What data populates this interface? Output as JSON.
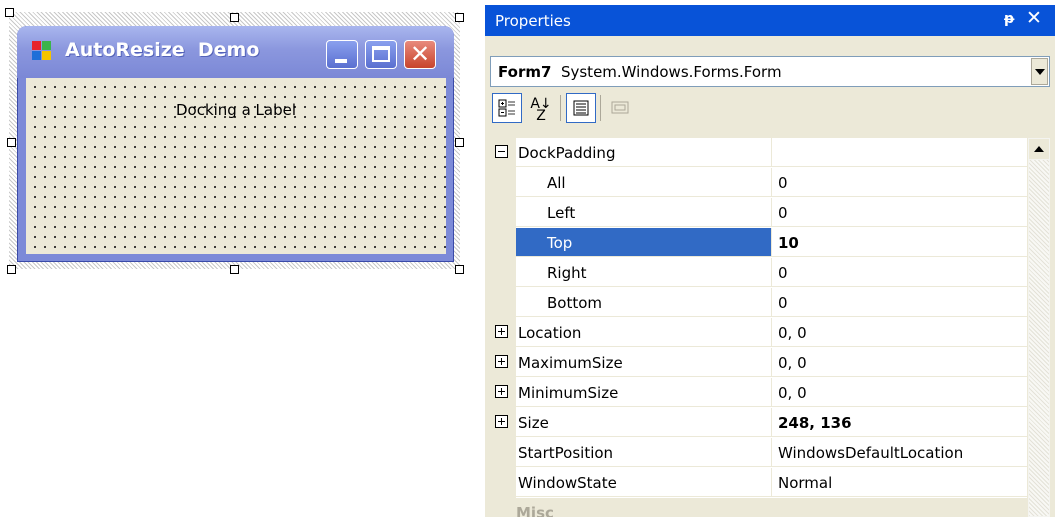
{
  "designer": {
    "form_title": "AutoResize  Demo",
    "label_text": "Docking a Label",
    "icons": {
      "app": "windows-form-icon",
      "minimize": "minimize-icon",
      "maximize": "maximize-icon",
      "close": "close-icon"
    }
  },
  "properties": {
    "title": "Properties",
    "pin_icon": "p",
    "close_icon": "✕",
    "object": {
      "name": "Form7",
      "type": "System.Windows.Forms.Form"
    },
    "toolbar": [
      {
        "name": "categorized-icon",
        "active": true
      },
      {
        "name": "alphabetical-icon",
        "active": false
      },
      {
        "name": "properties-view-icon",
        "active": true
      },
      {
        "name": "property-pages-icon",
        "active": false
      }
    ],
    "rows": [
      {
        "name": "DockPadding",
        "value": "",
        "expander": "minus",
        "indent": 0
      },
      {
        "name": "All",
        "value": "0",
        "indent": 1
      },
      {
        "name": "Left",
        "value": "0",
        "indent": 1
      },
      {
        "name": "Top",
        "value": "10",
        "indent": 1,
        "selected": true,
        "bold_value": true
      },
      {
        "name": "Right",
        "value": "0",
        "indent": 1
      },
      {
        "name": "Bottom",
        "value": "0",
        "indent": 1
      },
      {
        "name": "Location",
        "value": "0, 0",
        "expander": "plus",
        "indent": 0
      },
      {
        "name": "MaximumSize",
        "value": "0, 0",
        "expander": "plus",
        "indent": 0
      },
      {
        "name": "MinimumSize",
        "value": "0, 0",
        "expander": "plus",
        "indent": 0
      },
      {
        "name": "Size",
        "value": "248, 136",
        "expander": "plus",
        "indent": 0,
        "bold_value": true
      },
      {
        "name": "StartPosition",
        "value": "WindowsDefaultLocation",
        "indent": 0
      },
      {
        "name": "WindowState",
        "value": "Normal",
        "indent": 0
      },
      {
        "name": "Misc",
        "value": "",
        "expander": "minus",
        "indent": 0,
        "category": true
      }
    ]
  },
  "colors": {
    "titlebar_blue": "#0853d8",
    "selection_blue": "#316ac5",
    "panel_bg": "#ece9d8",
    "form_frame": "#7c8ad8"
  }
}
